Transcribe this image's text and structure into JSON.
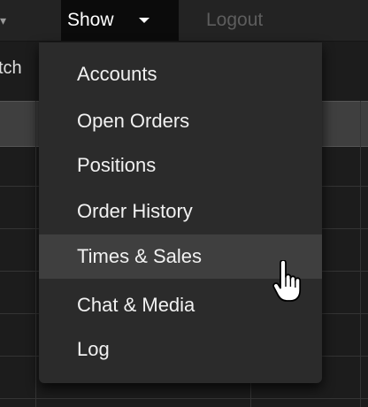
{
  "navbar": {
    "show_label": "Show",
    "logout_label": "Logout"
  },
  "page": {
    "title_fragment": "tch"
  },
  "menu": {
    "items": [
      {
        "label": "Accounts"
      },
      {
        "label": "Open Orders"
      },
      {
        "label": "Positions"
      },
      {
        "label": "Order History"
      },
      {
        "label": "Times & Sales"
      },
      {
        "label": "Chat & Media"
      },
      {
        "label": "Log"
      }
    ],
    "hovered_item": "Times & Sales"
  },
  "colors": {
    "navbar_bg": "#232323",
    "active_nav_bg": "#0b0b0b",
    "menu_bg": "#2b2b2b",
    "menu_hover_bg": "#3f3f3f",
    "menu_text": "#f1f1f1",
    "logout_text": "#5d5d5d"
  },
  "icons": {
    "show_caret": "caret-down-icon",
    "cursor": "hand-pointer-icon"
  }
}
